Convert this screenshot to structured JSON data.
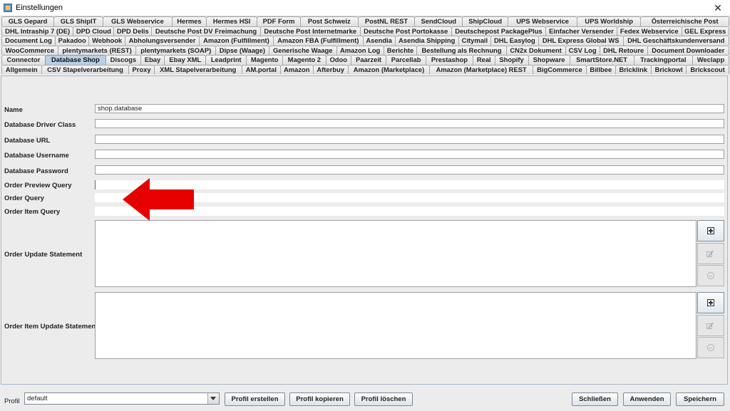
{
  "window": {
    "title": "Einstellungen",
    "close_glyph": "✕"
  },
  "tab_rows": [
    [
      "GLS Gepard",
      "GLS ShipIT",
      "GLS Webservice",
      "Hermes",
      "Hermes HSI",
      "PDF Form",
      "Post Schweiz",
      "PostNL REST",
      "SendCloud",
      "ShipCloud",
      "UPS Webservice",
      "UPS Worldship",
      "Österreichische Post"
    ],
    [
      "DHL Intraship 7 (DE)",
      "DPD Cloud",
      "DPD Delis",
      "Deutsche Post DV Freimachung",
      "Deutsche Post Internetmarke",
      "Deutsche Post Portokasse",
      "Deutschepost PackagePlus",
      "Einfacher Versender",
      "Fedex Webservice",
      "GEL Express"
    ],
    [
      "Document Log",
      "Pakadoo",
      "Webhook",
      "Abholungsversender",
      "Amazon (Fulfillment)",
      "Amazon FBA (Fulfillment)",
      "Asendia",
      "Asendia Shipping",
      "Citymail",
      "DHL Easylog",
      "DHL Express Global WS",
      "DHL Geschäftskundenversand"
    ],
    [
      "WooCommerce",
      "plentymarkets (REST)",
      "plentymarkets (SOAP)",
      "Dipse (Waage)",
      "Generische Waage",
      "Amazon Log",
      "Berichte",
      "Bestellung als Rechnung",
      "CN2x Dokument",
      "CSV Log",
      "DHL Retoure",
      "Document Downloader"
    ],
    [
      "Connector",
      "Database Shop",
      "Discogs",
      "Ebay",
      "Ebay XML",
      "Leadprint",
      "Magento",
      "Magento 2",
      "Odoo",
      "Paarzeit",
      "Parcellab",
      "Prestashop",
      "Real",
      "Shopify",
      "Shopware",
      "SmartStore.NET",
      "Trackingportal",
      "Weclapp"
    ],
    [
      "Allgemein",
      "CSV Stapelverarbeitung",
      "Proxy",
      "XML Stapelverarbeitung",
      "AM.portal",
      "Amazon",
      "Afterbuy",
      "Amazon (Marketplace)",
      "Amazon (Marketplace) REST",
      "BigCommerce",
      "Billbee",
      "Bricklink",
      "Brickowl",
      "Brickscout"
    ]
  ],
  "active_tab": "Database Shop",
  "form": {
    "name_label": "Name",
    "name_value": "shop.database",
    "driver_label": "Database Driver Class",
    "driver_value": "",
    "url_label": "Database URL",
    "url_value": "",
    "username_label": "Database Username",
    "username_value": "",
    "password_label": "Database Password",
    "password_value": "",
    "preview_query_label": "Order Preview Query",
    "preview_query_value": "",
    "order_query_label": "Order Query",
    "order_query_value": "",
    "item_query_label": "Order Item Query",
    "item_query_value": "",
    "update_stmt_label": "Order Update Statement",
    "item_update_stmt_label": "Order Item Update Statement"
  },
  "colors": {
    "arrow": "#e60000",
    "active_tab": "#b8cfe5"
  },
  "bottom": {
    "profil_label": "Profil",
    "profil_value": "default",
    "create_label": "Profil erstellen",
    "copy_label": "Profil kopieren",
    "delete_label": "Profil löschen",
    "close_label": "Schließen",
    "apply_label": "Anwenden",
    "save_label": "Speichern"
  }
}
